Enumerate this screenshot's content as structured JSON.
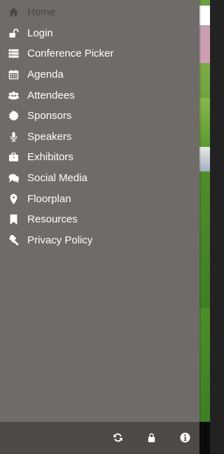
{
  "menu": {
    "items": [
      {
        "label": "Home",
        "icon": "home-icon"
      },
      {
        "label": "Login",
        "icon": "unlock-icon"
      },
      {
        "label": "Conference Picker",
        "icon": "list-icon"
      },
      {
        "label": "Agenda",
        "icon": "calendar-icon"
      },
      {
        "label": "Attendees",
        "icon": "users-icon"
      },
      {
        "label": "Sponsors",
        "icon": "certificate-icon"
      },
      {
        "label": "Speakers",
        "icon": "microphone-icon"
      },
      {
        "label": "Exhibitors",
        "icon": "briefcase-icon"
      },
      {
        "label": "Social Media",
        "icon": "comments-icon"
      },
      {
        "label": "Floorplan",
        "icon": "map-marker-icon"
      },
      {
        "label": "Resources",
        "icon": "bookmark-icon"
      },
      {
        "label": "Privacy Policy",
        "icon": "gavel-icon"
      }
    ]
  },
  "toolbar": {
    "buttons": [
      {
        "icon": "refresh-icon"
      },
      {
        "icon": "lock-icon"
      },
      {
        "icon": "info-icon"
      }
    ]
  },
  "colors": {
    "drawer": "#6f6b68",
    "toolbar": "#4d4a47",
    "text": "#ffffff",
    "faded_text": "#4a4744"
  }
}
